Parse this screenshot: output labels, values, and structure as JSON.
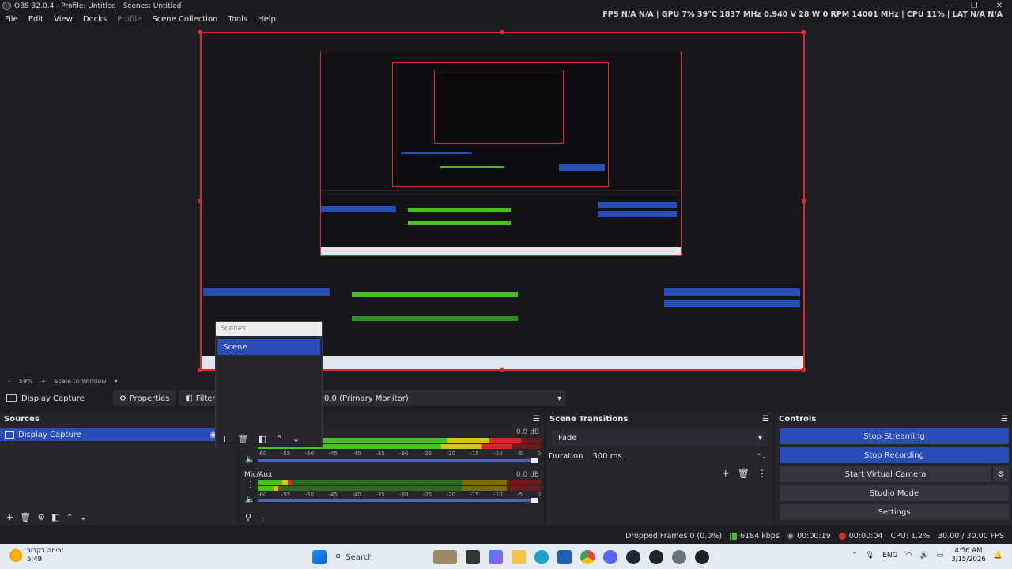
{
  "window": {
    "title": "OBS 32.0.4 - Profile: Untitled - Scenes: Untitled",
    "controls": [
      "—",
      "❐",
      "✕"
    ]
  },
  "menu": [
    "File",
    "Edit",
    "View",
    "Docks",
    "Profile",
    "Scene Collection",
    "Tools",
    "Help"
  ],
  "stats_overlay": "FPS  N/A  N/A   |  GPU  7%  39°C  1837 MHz  0.940 V  28 W  0 RPM  14001 MHz  |  CPU  11%  |  LAT  N/A  N/A",
  "preview": {
    "zoom_label": "59%",
    "scale_label": "Scale to Window"
  },
  "source_bar": {
    "source_name": "Display Capture",
    "properties": "Properties",
    "filters": "Filters",
    "display": "0.0 (Primary Monitor)"
  },
  "sources": {
    "title": "Sources",
    "items": [
      {
        "name": "Display Capture",
        "selected": true
      }
    ]
  },
  "scenes_popup": {
    "header": "Scenes",
    "items": [
      "Scene"
    ]
  },
  "mixer": {
    "tracks": [
      {
        "name": "",
        "db": "0.0 dB",
        "level": 0.93
      },
      {
        "name": "Mic/Aux",
        "db": "0.0 dB",
        "level": 0.12
      }
    ],
    "ticks": [
      "-60",
      "-55",
      "-50",
      "-45",
      "-40",
      "-35",
      "-30",
      "-25",
      "-20",
      "-15",
      "-10",
      "-5",
      "0"
    ]
  },
  "transitions": {
    "title": "Scene Transitions",
    "selected": "Fade",
    "duration_label": "Duration",
    "duration_value": "300 ms"
  },
  "controls": {
    "title": "Controls",
    "stop_streaming": "Stop Streaming",
    "stop_recording": "Stop Recording",
    "virtual_camera": "Start Virtual Camera",
    "studio_mode": "Studio Mode",
    "settings": "Settings"
  },
  "status": {
    "dropped": "Dropped Frames 0 (0.0%)",
    "bitrate": "6184 kbps",
    "stream_time": "00:00:19",
    "rec_time": "00:00:04",
    "cpu": "CPU: 1.2%",
    "fps": "30.00 / 30.00 FPS"
  },
  "taskbar": {
    "weather_line1": "זריחה בקרוב",
    "weather_line2": "5:49",
    "search": "Search",
    "lang": "ENG",
    "time": "4:56 AM",
    "date": "3/15/2026"
  },
  "colors": {
    "accent_blue": "#284cb8",
    "preview_border": "#e0262e"
  }
}
